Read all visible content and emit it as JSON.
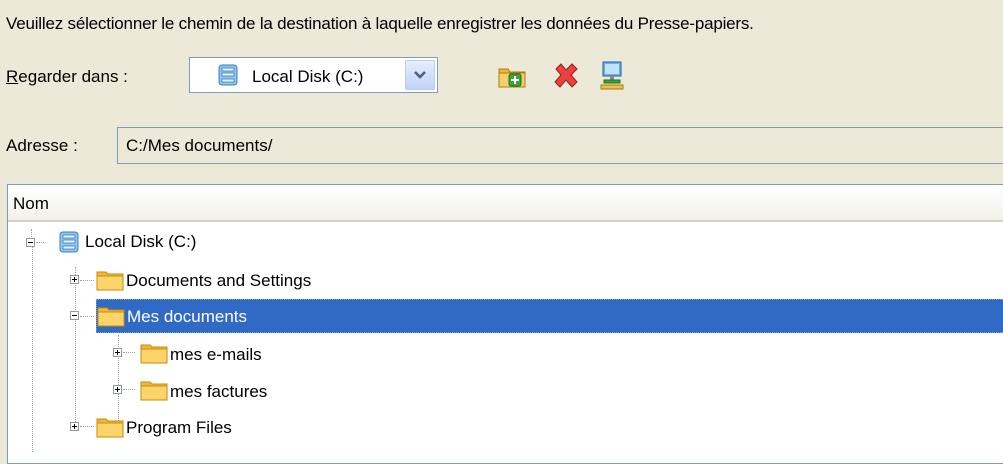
{
  "dialog": {
    "instruction": "Veuillez sélectionner le chemin de la destination à laquelle enregistrer les données du Presse-papiers.",
    "look_in": {
      "label_accel": "R",
      "label_rest": "egarder dans :",
      "selected": "Local Disk (C:)"
    },
    "toolbar": {
      "new_folder_icon": "new-folder-icon",
      "delete_icon": "delete-x-icon",
      "network_icon": "network-computer-icon"
    },
    "address": {
      "label": "Adresse :",
      "value": "C:/Mes documents/"
    },
    "tree": {
      "column_header": "Nom",
      "nodes": [
        {
          "label": "Local Disk (C:)",
          "icon": "drive-icon",
          "expanded": true
        },
        {
          "label": "Documents and Settings",
          "icon": "folder-icon",
          "expanded": false
        },
        {
          "label": "Mes documents",
          "icon": "folder-icon",
          "expanded": true,
          "selected": true
        },
        {
          "label": "mes e-mails",
          "icon": "folder-icon",
          "expanded": false
        },
        {
          "label": "mes factures",
          "icon": "folder-icon",
          "expanded": false
        },
        {
          "label": "Program Files",
          "icon": "folder-icon",
          "expanded": false
        }
      ]
    },
    "colors": {
      "background": "#ece9d8",
      "selection": "#316ac5",
      "border": "#7f9db9",
      "folder": "#f8c84a"
    }
  }
}
